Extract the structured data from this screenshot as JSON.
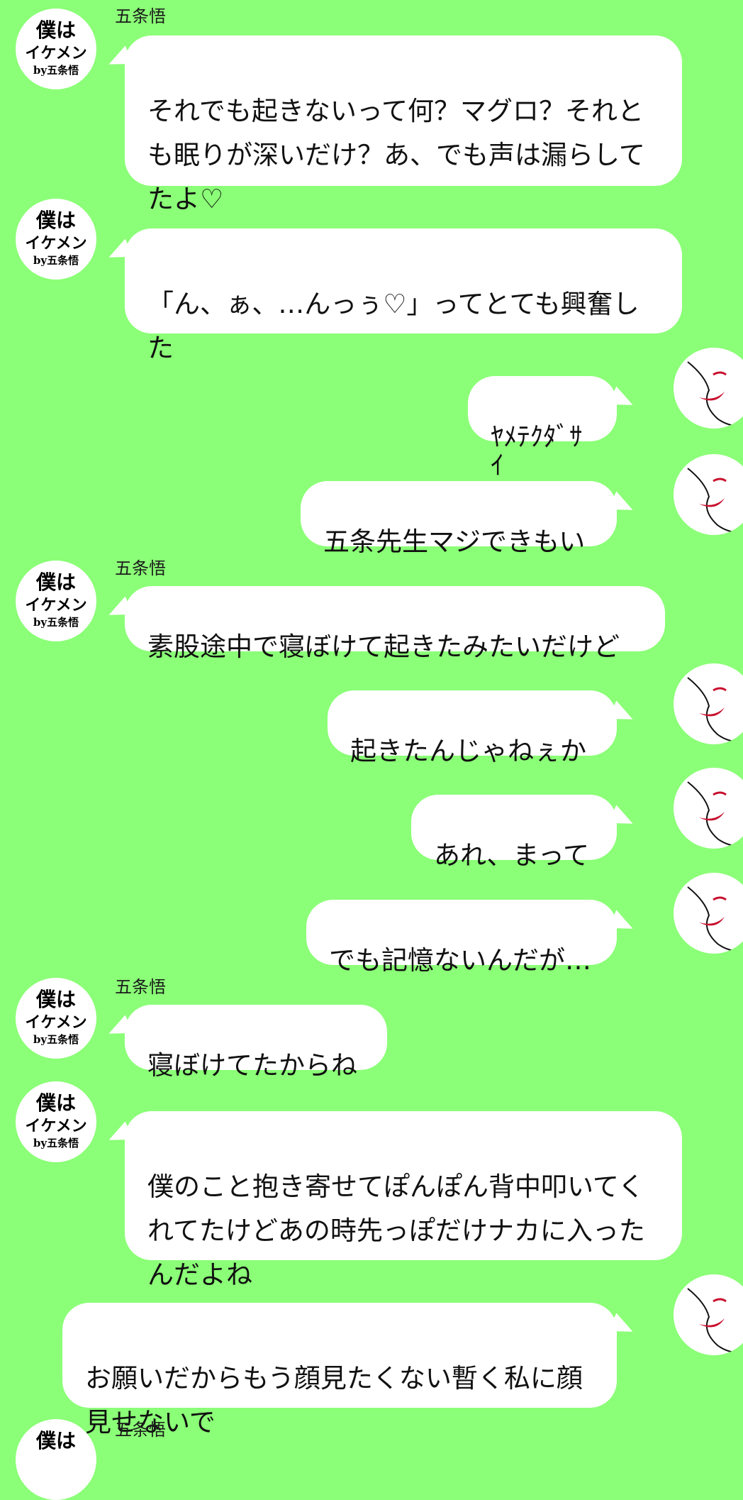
{
  "sender_name": "五条悟",
  "avatar_left_text": [
    "僕は",
    "イケメン",
    "by五条悟"
  ],
  "messages": [
    {
      "side": "left",
      "text": "それでも起きないって何？マグロ？それとも眠りが深いだけ？あ、でも声は漏らしてたよ♡"
    },
    {
      "side": "left",
      "text": "「ん、ぁ、…んっぅ♡」ってとても興奮した"
    },
    {
      "side": "right",
      "text": "ﾔﾒﾃｸﾀﾞｻｲ"
    },
    {
      "side": "right",
      "text": "五条先生マジできもい"
    },
    {
      "side": "left",
      "text": "素股途中で寝ぼけて起きたみたいだけど"
    },
    {
      "side": "right",
      "text": "起きたんじゃねぇか"
    },
    {
      "side": "right",
      "text": "あれ、まって"
    },
    {
      "side": "right",
      "text": "でも記憶ないんだが…"
    },
    {
      "side": "left",
      "text": "寝ぼけてたからね"
    },
    {
      "side": "left",
      "text": "僕のこと抱き寄せてぽんぽん背中叩いてくれてたけどあの時先っぽだけナカに入ったんだよね"
    },
    {
      "side": "right",
      "text": "お願いだからもう顔見たくない暫く私に顔見せないで"
    }
  ],
  "colors": {
    "background": "#8bff77",
    "bubble": "#ffffff",
    "lip_red": "#c8102e"
  }
}
